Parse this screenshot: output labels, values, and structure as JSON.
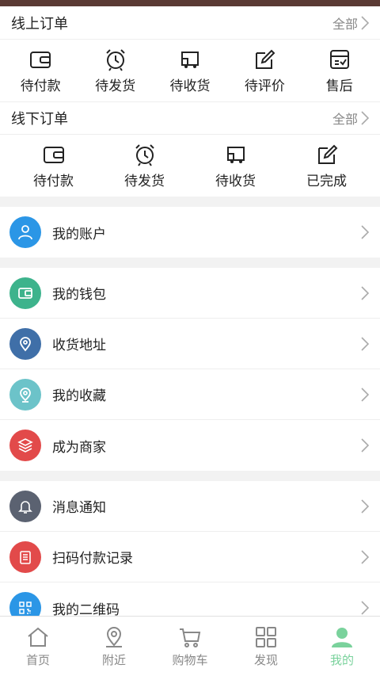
{
  "online_orders": {
    "title": "线上订单",
    "all_label": "全部",
    "items": [
      {
        "label": "待付款",
        "icon": "wallet-icon"
      },
      {
        "label": "待发货",
        "icon": "alarm-clock-icon"
      },
      {
        "label": "待收货",
        "icon": "delivery-truck-icon"
      },
      {
        "label": "待评价",
        "icon": "edit-icon"
      },
      {
        "label": "售后",
        "icon": "after-sales-box-icon"
      }
    ]
  },
  "offline_orders": {
    "title": "线下订单",
    "all_label": "全部",
    "items": [
      {
        "label": "待付款",
        "icon": "wallet-icon"
      },
      {
        "label": "待发货",
        "icon": "alarm-clock-icon"
      },
      {
        "label": "待收货",
        "icon": "delivery-truck-icon"
      },
      {
        "label": "已完成",
        "icon": "edit-icon"
      }
    ]
  },
  "menu_groups": [
    [
      {
        "label": "我的账户",
        "icon": "user-icon",
        "color": "#2b96e6"
      }
    ],
    [
      {
        "label": "我的钱包",
        "icon": "wallet-icon",
        "color": "#3db38c"
      },
      {
        "label": "收货地址",
        "icon": "location-pin-icon",
        "color": "#3f6fa8"
      },
      {
        "label": "我的收藏",
        "icon": "favorite-pin-icon",
        "color": "#6cc3c9"
      },
      {
        "label": "成为商家",
        "icon": "layers-icon",
        "color": "#e24a4a"
      }
    ],
    [
      {
        "label": "消息通知",
        "icon": "bell-icon",
        "color": "#5b6271"
      },
      {
        "label": "扫码付款记录",
        "icon": "clipboard-icon",
        "color": "#e24a4a"
      },
      {
        "label": "我的二维码",
        "icon": "qr-code-icon",
        "color": "#2b96e6"
      }
    ]
  ],
  "tabbar": {
    "items": [
      {
        "label": "首页",
        "icon": "home-icon"
      },
      {
        "label": "附近",
        "icon": "nearby-pin-icon"
      },
      {
        "label": "购物车",
        "icon": "cart-icon"
      },
      {
        "label": "发现",
        "icon": "grid-icon"
      },
      {
        "label": "我的",
        "icon": "profile-icon",
        "active": true
      }
    ],
    "active_color": "#7ad29c",
    "inactive_color": "#888888"
  }
}
